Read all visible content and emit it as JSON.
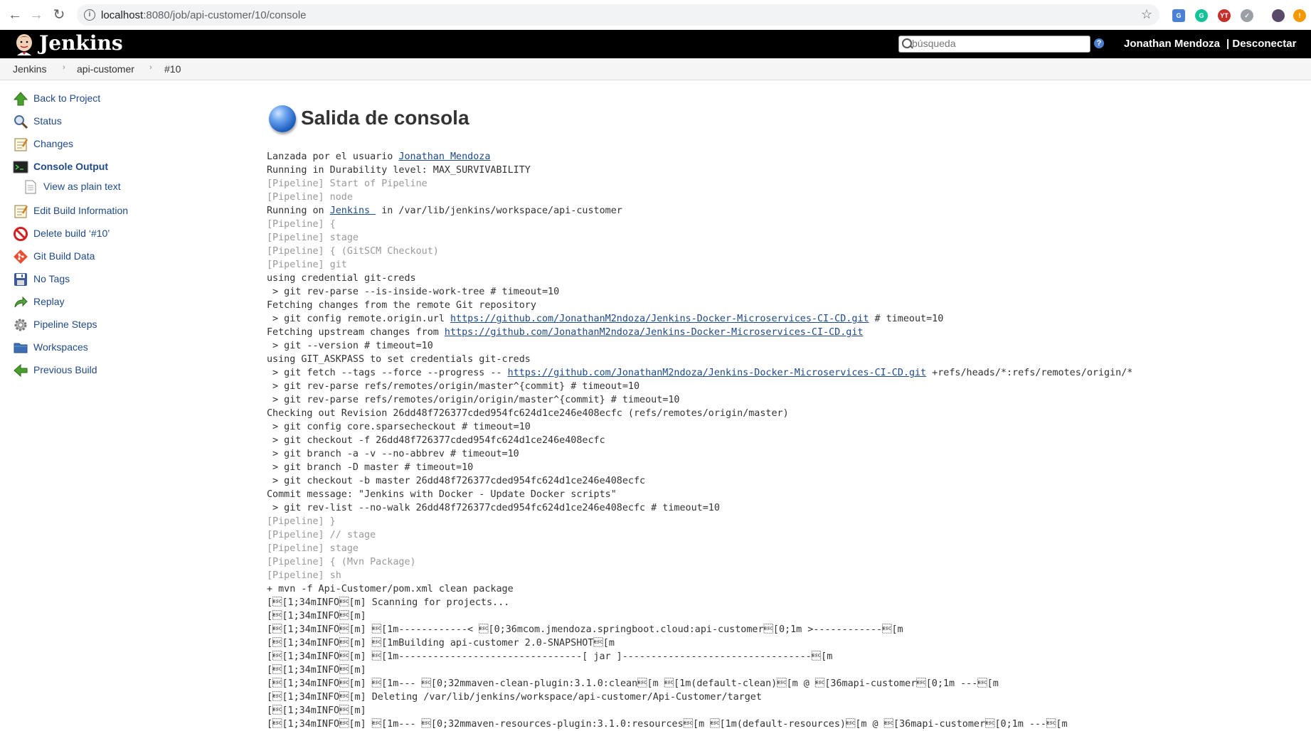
{
  "browser": {
    "url_host": "localhost",
    "url_rest": ":8080/job/api-customer/10/console"
  },
  "header": {
    "title": "Jenkins",
    "search_placeholder": "búsqueda",
    "user": "Jonathan Mendoza",
    "logout": "| Desconectar"
  },
  "breadcrumb": [
    "Jenkins",
    "api-customer",
    "#10"
  ],
  "sidebar": {
    "items": [
      {
        "label": "Back to Project",
        "icon": "up-arrow-icon"
      },
      {
        "label": "Status",
        "icon": "magnifier-icon"
      },
      {
        "label": "Changes",
        "icon": "notepad-icon"
      },
      {
        "label": "Console Output",
        "icon": "terminal-icon"
      },
      {
        "label": "View as plain text",
        "icon": "document-icon"
      },
      {
        "label": "Edit Build Information",
        "icon": "notepad-icon"
      },
      {
        "label": "Delete build ‘#10’",
        "icon": "no-entry-icon"
      },
      {
        "label": "Git Build Data",
        "icon": "git-icon"
      },
      {
        "label": "No Tags",
        "icon": "save-icon"
      },
      {
        "label": "Replay",
        "icon": "replay-arrow-icon"
      },
      {
        "label": "Pipeline Steps",
        "icon": "gear-icon"
      },
      {
        "label": "Workspaces",
        "icon": "folder-icon"
      },
      {
        "label": "Previous Build",
        "icon": "left-arrow-icon"
      }
    ]
  },
  "main": {
    "title": "Salida de consola",
    "launched_prefix": "Lanzada por el usuario ",
    "launched_user": "Jonathan Mendoza",
    "running_on_prefix": "Running on ",
    "running_on_node": "Jenkins ",
    "running_on_suffix": " in /var/lib/jenkins/workspace/api-customer",
    "repo_url": "https://github.com/JonathanM2ndoza/Jenkins-Docker-Microservices-CI-CD.git",
    "lines": [
      "Running in Durability level: MAX_SURVIVABILITY",
      "[Pipeline] Start of Pipeline",
      "[Pipeline] node",
      "[Pipeline] {",
      "[Pipeline] stage",
      "[Pipeline] { (GitSCM Checkout)",
      "[Pipeline] git",
      "using credential git-creds",
      " > git rev-parse --is-inside-work-tree # timeout=10",
      "Fetching changes from the remote Git repository",
      " > git config remote.origin.url ",
      " # timeout=10",
      "Fetching upstream changes from ",
      " > git --version # timeout=10",
      "using GIT_ASKPASS to set credentials git-creds",
      " > git fetch --tags --force --progress -- ",
      " +refs/heads/*:refs/remotes/origin/*",
      " > git rev-parse refs/remotes/origin/master^{commit} # timeout=10",
      " > git rev-parse refs/remotes/origin/origin/master^{commit} # timeout=10",
      "Checking out Revision 26dd48f726377cded954fc624d1ce246e408ecfc (refs/remotes/origin/master)",
      " > git config core.sparsecheckout # timeout=10",
      " > git checkout -f 26dd48f726377cded954fc624d1ce246e408ecfc",
      " > git branch -a -v --no-abbrev # timeout=10",
      " > git branch -D master # timeout=10",
      " > git checkout -b master 26dd48f726377cded954fc624d1ce246e408ecfc",
      "Commit message: \"Jenkins with Docker - Update Docker scripts\"",
      " > git rev-list --no-walk 26dd48f726377cded954fc624d1ce246e408ecfc # timeout=10",
      "[Pipeline] }",
      "[Pipeline] // stage",
      "[Pipeline] stage",
      "[Pipeline] { (Mvn Package)",
      "[Pipeline] sh",
      "+ mvn -f Api-Customer/pom.xml clean package",
      "[\u001b[1;34mINFO\u001b[m] Scanning for projects...",
      "[\u001b[1;34mINFO\u001b[m]",
      "[\u001b[1;34mINFO\u001b[m] \u001b[1m------------< \u001b[0;36mcom.jmendoza.springboot.cloud:api-customer\u001b[0;1m >------------\u001b[m",
      "[\u001b[1;34mINFO\u001b[m] \u001b[1mBuilding api-customer 2.0-SNAPSHOT\u001b[m",
      "[\u001b[1;34mINFO\u001b[m] \u001b[1m--------------------------------[ jar ]---------------------------------\u001b[m",
      "[\u001b[1;34mINFO\u001b[m]",
      "[\u001b[1;34mINFO\u001b[m] \u001b[1m--- \u001b[0;32mmaven-clean-plugin:3.1.0:clean\u001b[m \u001b[1m(default-clean)\u001b[m @ \u001b[36mapi-customer\u001b[0;1m ---\u001b[m",
      "[\u001b[1;34mINFO\u001b[m] Deleting /var/lib/jenkins/workspace/api-customer/Api-Customer/target",
      "[\u001b[1;34mINFO\u001b[m]",
      "[\u001b[1;34mINFO\u001b[m] \u001b[1m--- \u001b[0;32mmaven-resources-plugin:3.1.0:resources\u001b[m \u001b[1m(default-resources)\u001b[m @ \u001b[36mapi-customer\u001b[0;1m ---\u001b[m"
    ]
  }
}
